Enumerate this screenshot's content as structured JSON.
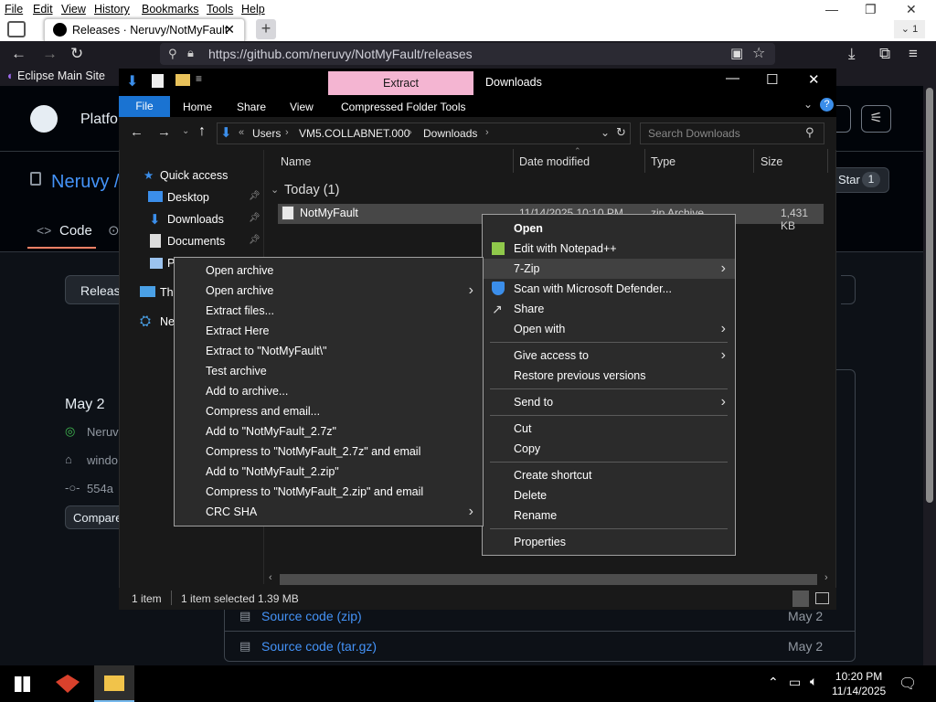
{
  "firefox": {
    "menu": [
      "File",
      "Edit",
      "View",
      "History",
      "Bookmarks",
      "Tools",
      "Help"
    ],
    "tab_title": "Releases · Neruvy/NotMyFault",
    "tab_overflow_count": "1",
    "url": "https://github.com/neruvy/NotMyFault/releases",
    "bookmark": "Eclipse Main Site"
  },
  "github": {
    "platform_label": "Platfo",
    "repo_name": "Neruvy /",
    "code_tab": "Code",
    "star_label": "Star",
    "star_count": "1",
    "releases_button": "Releas",
    "release_date": "May 2",
    "author_partial": "Neruv",
    "tag_partial": "windo",
    "commit_partial": "554a",
    "compare_button": "Compare",
    "assets": [
      {
        "label": "Source code (zip)",
        "date": "May 2"
      },
      {
        "label": "Source code (tar.gz)",
        "date": "May 2"
      }
    ]
  },
  "explorer": {
    "context_tab": "Extract",
    "window_title": "Downloads",
    "ribbon_tabs": [
      "File",
      "Home",
      "Share",
      "View",
      "Compressed Folder Tools"
    ],
    "breadcrumb": [
      "Users",
      "VM5.COLLABNET.000",
      "Downloads"
    ],
    "search_placeholder": "Search Downloads",
    "nav": {
      "quick_access": "Quick access",
      "desktop": "Desktop",
      "downloads": "Downloads",
      "documents": "Documents",
      "pictures_partial": "P",
      "this_pc_partial": "Thi",
      "network_partial": "Ne"
    },
    "columns": {
      "name": "Name",
      "date": "Date modified",
      "type": "Type",
      "size": "Size"
    },
    "group_label": "Today (1)",
    "file": {
      "name": "NotMyFault",
      "date": "11/14/2025 10:10 PM",
      "type": "zip Archive",
      "size": "1,431 KB"
    },
    "status": {
      "count": "1 item",
      "selected": "1 item selected  1.39 MB"
    }
  },
  "context_menu": {
    "items": [
      {
        "label": "Open",
        "bold": true
      },
      {
        "label": "Edit with Notepad++"
      },
      {
        "label": "7-Zip",
        "submenu": true
      },
      {
        "label": "Scan with Microsoft Defender..."
      },
      {
        "label": "Share"
      },
      {
        "label": "Open with",
        "submenu": true
      },
      {
        "label": "Give access to",
        "submenu": true
      },
      {
        "label": "Restore previous versions"
      },
      {
        "label": "Send to",
        "submenu": true
      },
      {
        "label": "Cut"
      },
      {
        "label": "Copy"
      },
      {
        "label": "Create shortcut"
      },
      {
        "label": "Delete"
      },
      {
        "label": "Rename"
      },
      {
        "label": "Properties"
      }
    ]
  },
  "zip_menu": {
    "items": [
      {
        "label": "Open archive"
      },
      {
        "label": "Open archive",
        "submenu": true
      },
      {
        "label": "Extract files..."
      },
      {
        "label": "Extract Here"
      },
      {
        "label": "Extract to \"NotMyFault\\\""
      },
      {
        "label": "Test archive"
      },
      {
        "label": "Add to archive..."
      },
      {
        "label": "Compress and email..."
      },
      {
        "label": "Add to \"NotMyFault_2.7z\""
      },
      {
        "label": "Compress to \"NotMyFault_2.7z\" and email"
      },
      {
        "label": "Add to \"NotMyFault_2.zip\""
      },
      {
        "label": "Compress to \"NotMyFault_2.zip\" and email"
      },
      {
        "label": "CRC SHA",
        "submenu": true
      }
    ]
  },
  "taskbar": {
    "time": "10:20 PM",
    "date": "11/14/2025"
  },
  "colors": {
    "explorer_bg": "#191919",
    "extract_tab": "#f4b5d2",
    "file_tab": "#1a73d2",
    "github_link": "#4493f8",
    "menu_bg": "#2b2b2b"
  }
}
